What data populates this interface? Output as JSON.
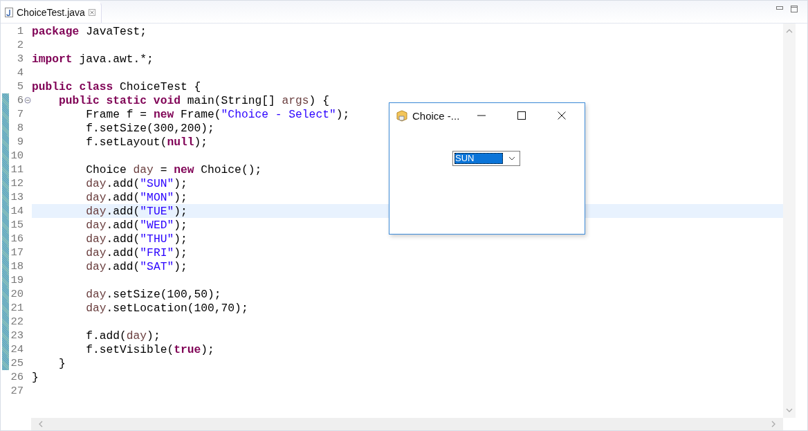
{
  "editor_tab": {
    "label": "ChoiceTest.java",
    "selected": true
  },
  "lines": [
    {
      "number": "1",
      "current": false,
      "changed": false,
      "foldable": false,
      "tokens": [
        {
          "kind": "kw",
          "text": "package"
        },
        {
          "kind": "plain",
          "text": " JavaTest;"
        }
      ]
    },
    {
      "number": "2",
      "current": false,
      "changed": false,
      "foldable": false
    },
    {
      "number": "3",
      "current": false,
      "changed": false,
      "foldable": false,
      "tokens": [
        {
          "kind": "kw",
          "text": "import"
        },
        {
          "kind": "plain",
          "text": " java.awt.*;"
        }
      ]
    },
    {
      "number": "4",
      "current": false,
      "changed": false,
      "foldable": false
    },
    {
      "number": "5",
      "current": false,
      "changed": false,
      "foldable": false,
      "tokens": [
        {
          "kind": "kw",
          "text": "public class"
        },
        {
          "kind": "plain",
          "text": " ChoiceTest {"
        }
      ]
    },
    {
      "number": "6",
      "current": false,
      "changed": true,
      "foldable": true,
      "tokens": [
        {
          "kind": "kw",
          "text": "    public static void"
        },
        {
          "kind": "plain",
          "text": " main(String[] "
        },
        {
          "kind": "var",
          "text": "args"
        },
        {
          "kind": "plain",
          "text": ") {"
        }
      ]
    },
    {
      "number": "7",
      "current": false,
      "changed": true,
      "foldable": false,
      "tokens": [
        {
          "kind": "plain",
          "text": "        Frame f = "
        },
        {
          "kind": "kw",
          "text": "new"
        },
        {
          "kind": "plain",
          "text": " Frame("
        },
        {
          "kind": "str",
          "text": "\"Choice - Select\""
        },
        {
          "kind": "plain",
          "text": ");"
        }
      ]
    },
    {
      "number": "8",
      "current": false,
      "changed": true,
      "foldable": false,
      "tokens": [
        {
          "kind": "plain",
          "text": "        f.setSize(300,200);"
        }
      ]
    },
    {
      "number": "9",
      "current": false,
      "changed": true,
      "foldable": false,
      "tokens": [
        {
          "kind": "plain",
          "text": "        f.setLayout("
        },
        {
          "kind": "kw",
          "text": "null"
        },
        {
          "kind": "plain",
          "text": ");"
        }
      ]
    },
    {
      "number": "10",
      "current": false,
      "changed": true,
      "foldable": false
    },
    {
      "number": "11",
      "current": false,
      "changed": true,
      "foldable": false,
      "tokens": [
        {
          "kind": "plain",
          "text": "        Choice "
        },
        {
          "kind": "var",
          "text": "day"
        },
        {
          "kind": "plain",
          "text": " = "
        },
        {
          "kind": "kw",
          "text": "new"
        },
        {
          "kind": "plain",
          "text": " Choice();"
        }
      ]
    },
    {
      "number": "12",
      "current": false,
      "changed": true,
      "foldable": false,
      "tokens": [
        {
          "kind": "var",
          "text": "        day"
        },
        {
          "kind": "plain",
          "text": ".add("
        },
        {
          "kind": "str",
          "text": "\"SUN\""
        },
        {
          "kind": "plain",
          "text": ");"
        }
      ]
    },
    {
      "number": "13",
      "current": false,
      "changed": true,
      "foldable": false,
      "tokens": [
        {
          "kind": "var",
          "text": "        day"
        },
        {
          "kind": "plain",
          "text": ".add("
        },
        {
          "kind": "str",
          "text": "\"MON\""
        },
        {
          "kind": "plain",
          "text": ");"
        }
      ]
    },
    {
      "number": "14",
      "current": true,
      "changed": true,
      "foldable": false,
      "tokens": [
        {
          "kind": "var",
          "text": "        day"
        },
        {
          "kind": "plain",
          "text": ".add("
        },
        {
          "kind": "str",
          "text": "\"TUE\""
        },
        {
          "kind": "plain",
          "text": ");"
        }
      ]
    },
    {
      "number": "15",
      "current": false,
      "changed": true,
      "foldable": false,
      "tokens": [
        {
          "kind": "var",
          "text": "        day"
        },
        {
          "kind": "plain",
          "text": ".add("
        },
        {
          "kind": "str",
          "text": "\"WED\""
        },
        {
          "kind": "plain",
          "text": ");"
        }
      ]
    },
    {
      "number": "16",
      "current": false,
      "changed": true,
      "foldable": false,
      "tokens": [
        {
          "kind": "var",
          "text": "        day"
        },
        {
          "kind": "plain",
          "text": ".add("
        },
        {
          "kind": "str",
          "text": "\"THU\""
        },
        {
          "kind": "plain",
          "text": ");"
        }
      ]
    },
    {
      "number": "17",
      "current": false,
      "changed": true,
      "foldable": false,
      "tokens": [
        {
          "kind": "var",
          "text": "        day"
        },
        {
          "kind": "plain",
          "text": ".add("
        },
        {
          "kind": "str",
          "text": "\"FRI\""
        },
        {
          "kind": "plain",
          "text": ");"
        }
      ]
    },
    {
      "number": "18",
      "current": false,
      "changed": true,
      "foldable": false,
      "tokens": [
        {
          "kind": "var",
          "text": "        day"
        },
        {
          "kind": "plain",
          "text": ".add("
        },
        {
          "kind": "str",
          "text": "\"SAT\""
        },
        {
          "kind": "plain",
          "text": ");"
        }
      ]
    },
    {
      "number": "19",
      "current": false,
      "changed": true,
      "foldable": false
    },
    {
      "number": "20",
      "current": false,
      "changed": true,
      "foldable": false,
      "tokens": [
        {
          "kind": "var",
          "text": "        day"
        },
        {
          "kind": "plain",
          "text": ".setSize(100,50);"
        }
      ]
    },
    {
      "number": "21",
      "current": false,
      "changed": true,
      "foldable": false,
      "tokens": [
        {
          "kind": "var",
          "text": "        day"
        },
        {
          "kind": "plain",
          "text": ".setLocation(100,70);"
        }
      ]
    },
    {
      "number": "22",
      "current": false,
      "changed": true,
      "foldable": false
    },
    {
      "number": "23",
      "current": false,
      "changed": true,
      "foldable": false,
      "tokens": [
        {
          "kind": "plain",
          "text": "        f.add("
        },
        {
          "kind": "var",
          "text": "day"
        },
        {
          "kind": "plain",
          "text": ");"
        }
      ]
    },
    {
      "number": "24",
      "current": false,
      "changed": true,
      "foldable": false,
      "tokens": [
        {
          "kind": "plain",
          "text": "        f.setVisible("
        },
        {
          "kind": "kw",
          "text": "true"
        },
        {
          "kind": "plain",
          "text": ");"
        }
      ]
    },
    {
      "number": "25",
      "current": false,
      "changed": true,
      "foldable": false,
      "tokens": [
        {
          "kind": "plain",
          "text": "    }"
        }
      ]
    },
    {
      "number": "26",
      "current": false,
      "changed": false,
      "foldable": false,
      "tokens": [
        {
          "kind": "plain",
          "text": "}"
        }
      ]
    },
    {
      "number": "27",
      "current": false,
      "changed": false,
      "foldable": false
    }
  ],
  "dialog": {
    "title": "Choice -...",
    "choice": {
      "value": "SUN",
      "selected": true
    }
  }
}
